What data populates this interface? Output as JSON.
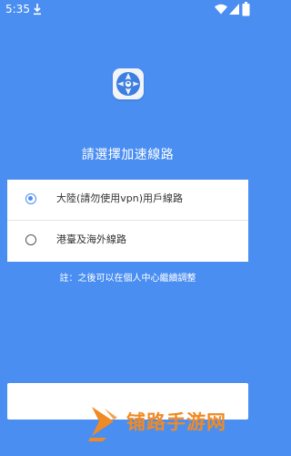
{
  "status_bar": {
    "time": "5:35",
    "icons": [
      "download-icon",
      "wifi-icon",
      "signal-icon",
      "battery-icon"
    ]
  },
  "colors": {
    "background": "#4a8ef2",
    "card": "#ffffff",
    "radio_active": "#4a8ef2",
    "watermark": "#f08a24"
  },
  "app": {
    "logo_icon": "app-logo-icon"
  },
  "title": "請選擇加速線路",
  "options": [
    {
      "label": "大陸(請勿使用vpn)用戶線路",
      "selected": true
    },
    {
      "label": "港臺及海外線路",
      "selected": false
    }
  ],
  "note": "註：之後可以在個人中心繼續調整",
  "watermark": {
    "text": "铺路手游网",
    "icon": "watermark-logo-icon"
  }
}
